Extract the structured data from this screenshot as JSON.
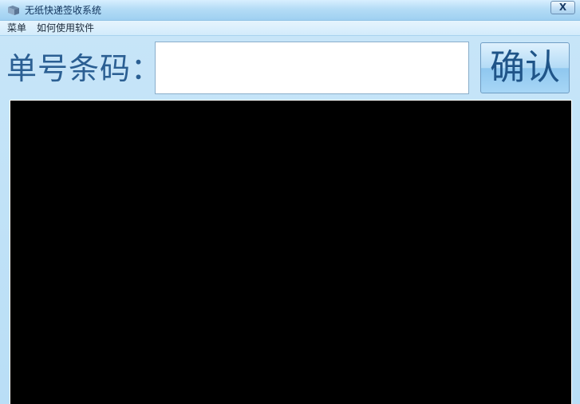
{
  "window": {
    "title": "无纸快递签收系统",
    "close_label": "X",
    "icon": "app-logo-icon"
  },
  "menubar": {
    "items": [
      {
        "label": "菜单"
      },
      {
        "label": "如何使用软件"
      }
    ]
  },
  "form": {
    "barcode_label": "单号条码：",
    "barcode_value": "",
    "barcode_placeholder": "",
    "confirm_label": "确认"
  },
  "log": {
    "text": ""
  },
  "colors": {
    "titlebar": "#b4dcf6",
    "background": "#bfe0f6",
    "label_text": "#2b5f93",
    "log_background": "#000000"
  }
}
